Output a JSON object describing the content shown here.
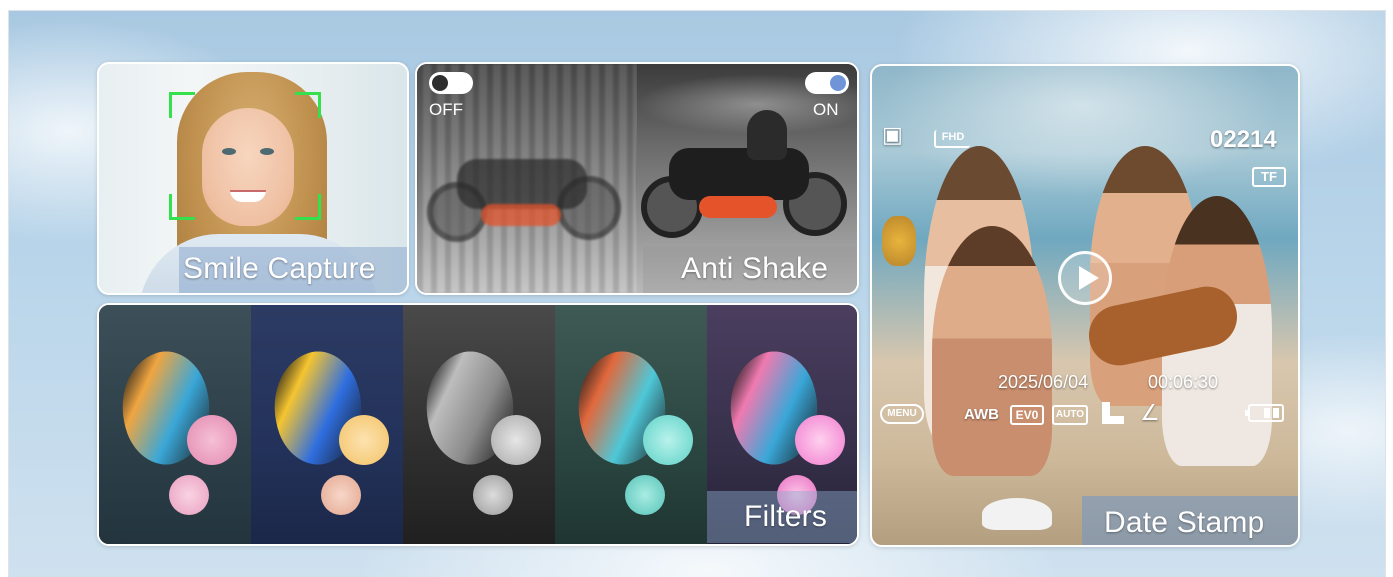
{
  "panels": {
    "smile": {
      "caption": "Smile Capture"
    },
    "shake": {
      "caption": "Anti Shake",
      "toggle_off_label": "OFF",
      "toggle_on_label": "ON"
    },
    "filters": {
      "caption": "Filters"
    },
    "datestamp": {
      "caption": "Date Stamp",
      "counter": "02214",
      "date": "2025/06/04",
      "time": "00:06:30",
      "badge_fhd": "FHD",
      "badge_tf": "TF",
      "badge_menu": "MENU",
      "badge_awb": "AWB",
      "badge_ev": "EV0",
      "badge_auto": "AUTO"
    }
  },
  "colors": {
    "face_box": "#34e14d",
    "toggle_on": "#6f95d8",
    "caption_bg": "#8caacd"
  }
}
